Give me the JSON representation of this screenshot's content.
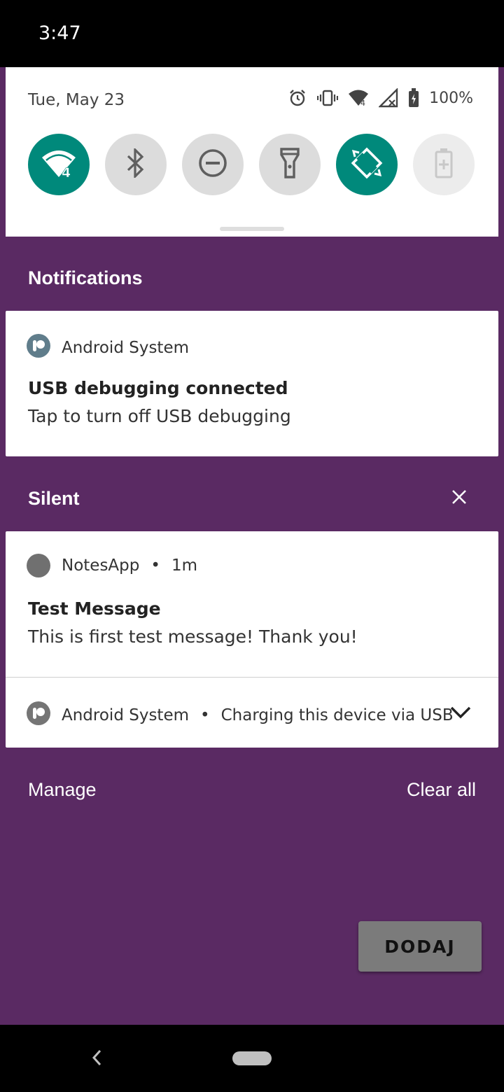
{
  "status_bar": {
    "time": "3:47"
  },
  "quick_settings": {
    "date": "Tue, May 23",
    "battery_percent": "100%",
    "wifi_badge": "4",
    "accent_color": "#00897b",
    "tiles": [
      {
        "name": "wifi",
        "icon": "wifi-icon",
        "state": "on"
      },
      {
        "name": "bluetooth",
        "icon": "bluetooth-icon",
        "state": "off"
      },
      {
        "name": "do-not-disturb",
        "icon": "dnd-icon",
        "state": "off"
      },
      {
        "name": "flashlight",
        "icon": "flashlight-icon",
        "state": "off"
      },
      {
        "name": "auto-rotate",
        "icon": "rotate-icon",
        "state": "on"
      },
      {
        "name": "battery-saver",
        "icon": "battery-saver-icon",
        "state": "disabled"
      }
    ]
  },
  "notifications_section": {
    "header": "Notifications",
    "usb_debug": {
      "app_name": "Android System",
      "title": "USB debugging connected",
      "text": "Tap to turn off USB debugging"
    }
  },
  "silent_section": {
    "header": "Silent",
    "notes_app": {
      "app_name": "NotesApp",
      "time": "1m",
      "title": "Test Message",
      "text": "This is first test message! Thank you!"
    },
    "charging": {
      "app_name": "Android System",
      "text": "Charging this device via USB"
    }
  },
  "footer": {
    "manage": "Manage",
    "clear_all": "Clear all"
  },
  "app_button": {
    "label": "DODAJ"
  },
  "background_color": "#5a2a63"
}
